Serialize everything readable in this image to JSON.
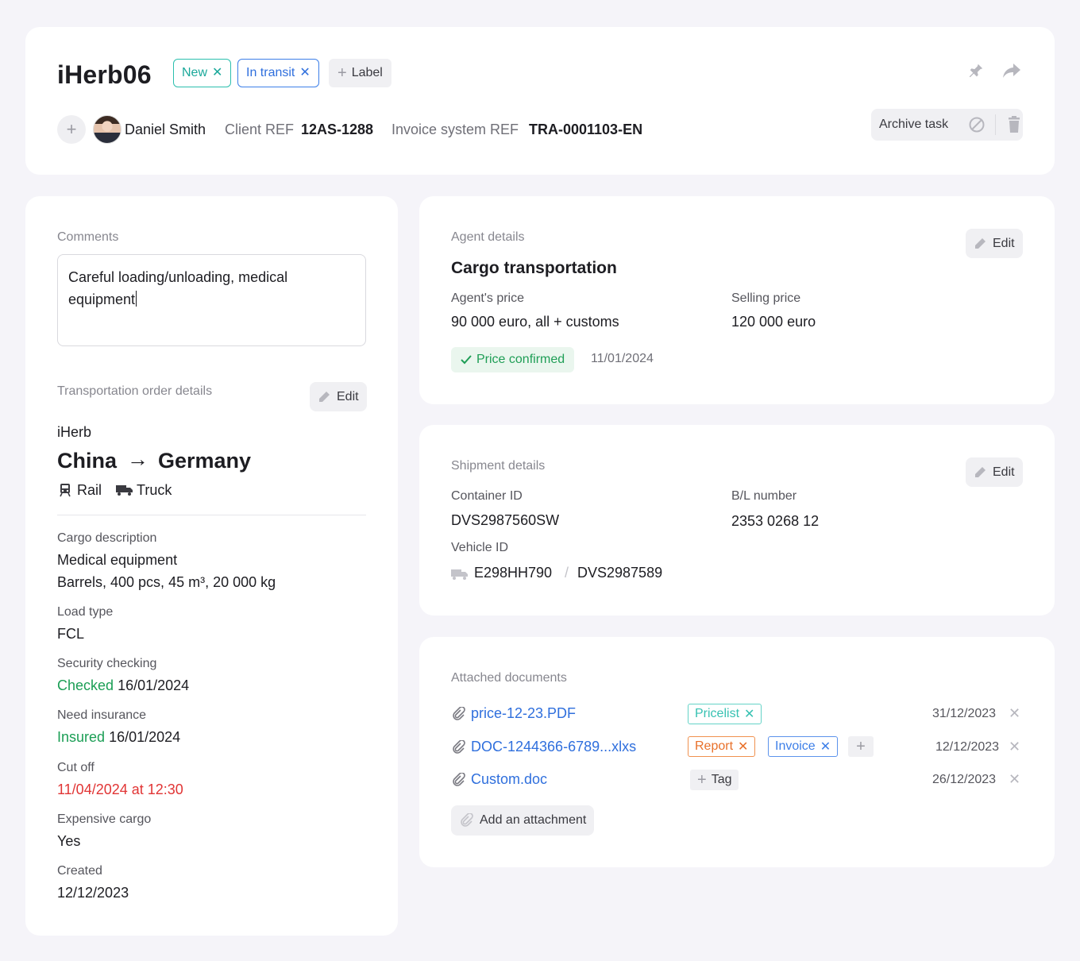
{
  "header": {
    "title": "iHerb06",
    "tags": [
      {
        "label": "New",
        "remove": "✕"
      },
      {
        "label": "In transit",
        "remove": "✕"
      }
    ],
    "add_label": "Label",
    "assignee": "Daniel Smith",
    "client_ref_label": "Client REF",
    "client_ref_value": "12AS-1288",
    "invoice_ref_label": "Invoice system REF",
    "invoice_ref_value": "TRA-0001103-EN",
    "archive_label": "Archive task"
  },
  "comments": {
    "label": "Comments",
    "line1": "Careful loading/unloading, medical",
    "line2": "equipment"
  },
  "order": {
    "label": "Transportation order details",
    "edit": "Edit",
    "company": "iHerb",
    "from": "China",
    "arrow": "→",
    "to": "Germany",
    "mode1": "Rail",
    "mode2": "Truck",
    "cargo_label": "Cargo description",
    "cargo_line1": "Medical equipment",
    "cargo_line2": "Barrels, 400 pcs, 45 m³, 20 000 kg",
    "load_label": "Load type",
    "load_value": "FCL",
    "security_label": "Security checking",
    "security_status": "Checked",
    "security_date": "16/01/2024",
    "insurance_label": "Need insurance",
    "insurance_status": "Insured",
    "insurance_date": "16/01/2024",
    "cutoff_label": "Cut off",
    "cutoff_value": "11/04/2024 at 12:30",
    "expensive_label": "Expensive cargo",
    "expensive_value": "Yes",
    "created_label": "Created",
    "created_value": "12/12/2023"
  },
  "agent": {
    "label": "Agent details",
    "edit": "Edit",
    "title": "Cargo transportation",
    "agent_price_label": "Agent's price",
    "agent_price_value": "90 000 euro, all + customs",
    "selling_price_label": "Selling price",
    "selling_price_value": "120 000 euro",
    "confirmed_label": "Price confirmed",
    "confirmed_date": "11/01/2024"
  },
  "shipment": {
    "label": "Shipment details",
    "edit": "Edit",
    "container_label": "Container ID",
    "container_value": "DVS2987560SW",
    "bl_label": "B/L number",
    "bl_value": "2353 0268 12",
    "vehicle_label": "Vehicle ID",
    "vehicle_value1": "E298HH790",
    "vehicle_sep": "/",
    "vehicle_value2": "DVS2987589"
  },
  "documents": {
    "label": "Attached documents",
    "files": [
      {
        "name": "price-12-23.PDF",
        "date": "31/12/2023",
        "remove": "✕"
      },
      {
        "name": "DOC-1244366-6789...xlxs",
        "date": "12/12/2023",
        "remove": "✕"
      },
      {
        "name": "Custom.doc",
        "date": "26/12/2023",
        "remove": "✕"
      }
    ],
    "tag_pricelist": "Pricelist",
    "tag_report": "Report",
    "tag_invoice": "Invoice",
    "tag_add": "Tag",
    "tag_remove": "✕",
    "add_attachment": "Add an attachment"
  },
  "colors": {
    "background": "#f5f4f9",
    "link_blue": "#2f6fdd",
    "status_green": "#1b9e55",
    "alert_red": "#e13535",
    "teal": "#1aa89a"
  }
}
